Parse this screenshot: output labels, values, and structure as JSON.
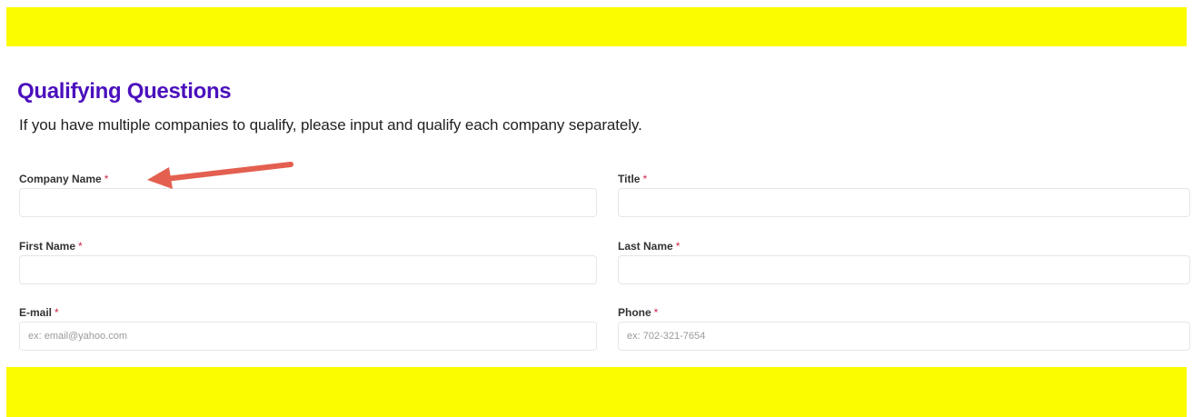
{
  "form": {
    "heading": "Qualifying Questions",
    "subtext": "If you have multiple companies to qualify, please input and qualify each company separately.",
    "required_marker": "*",
    "fields": {
      "company_name": {
        "label": "Company Name",
        "placeholder": ""
      },
      "title": {
        "label": "Title",
        "placeholder": ""
      },
      "first_name": {
        "label": "First Name",
        "placeholder": ""
      },
      "last_name": {
        "label": "Last Name",
        "placeholder": ""
      },
      "email": {
        "label": "E-mail",
        "placeholder": "ex: email@yahoo.com"
      },
      "phone": {
        "label": "Phone",
        "placeholder": "ex: 702-321-7654"
      }
    }
  },
  "colors": {
    "highlight_band": "#fcfc00",
    "heading": "#4b10bd",
    "required_marker": "#d0254a",
    "annotation_arrow": "#e35f4f"
  },
  "annotation": {
    "icon": "arrow-pointing-left-icon"
  }
}
